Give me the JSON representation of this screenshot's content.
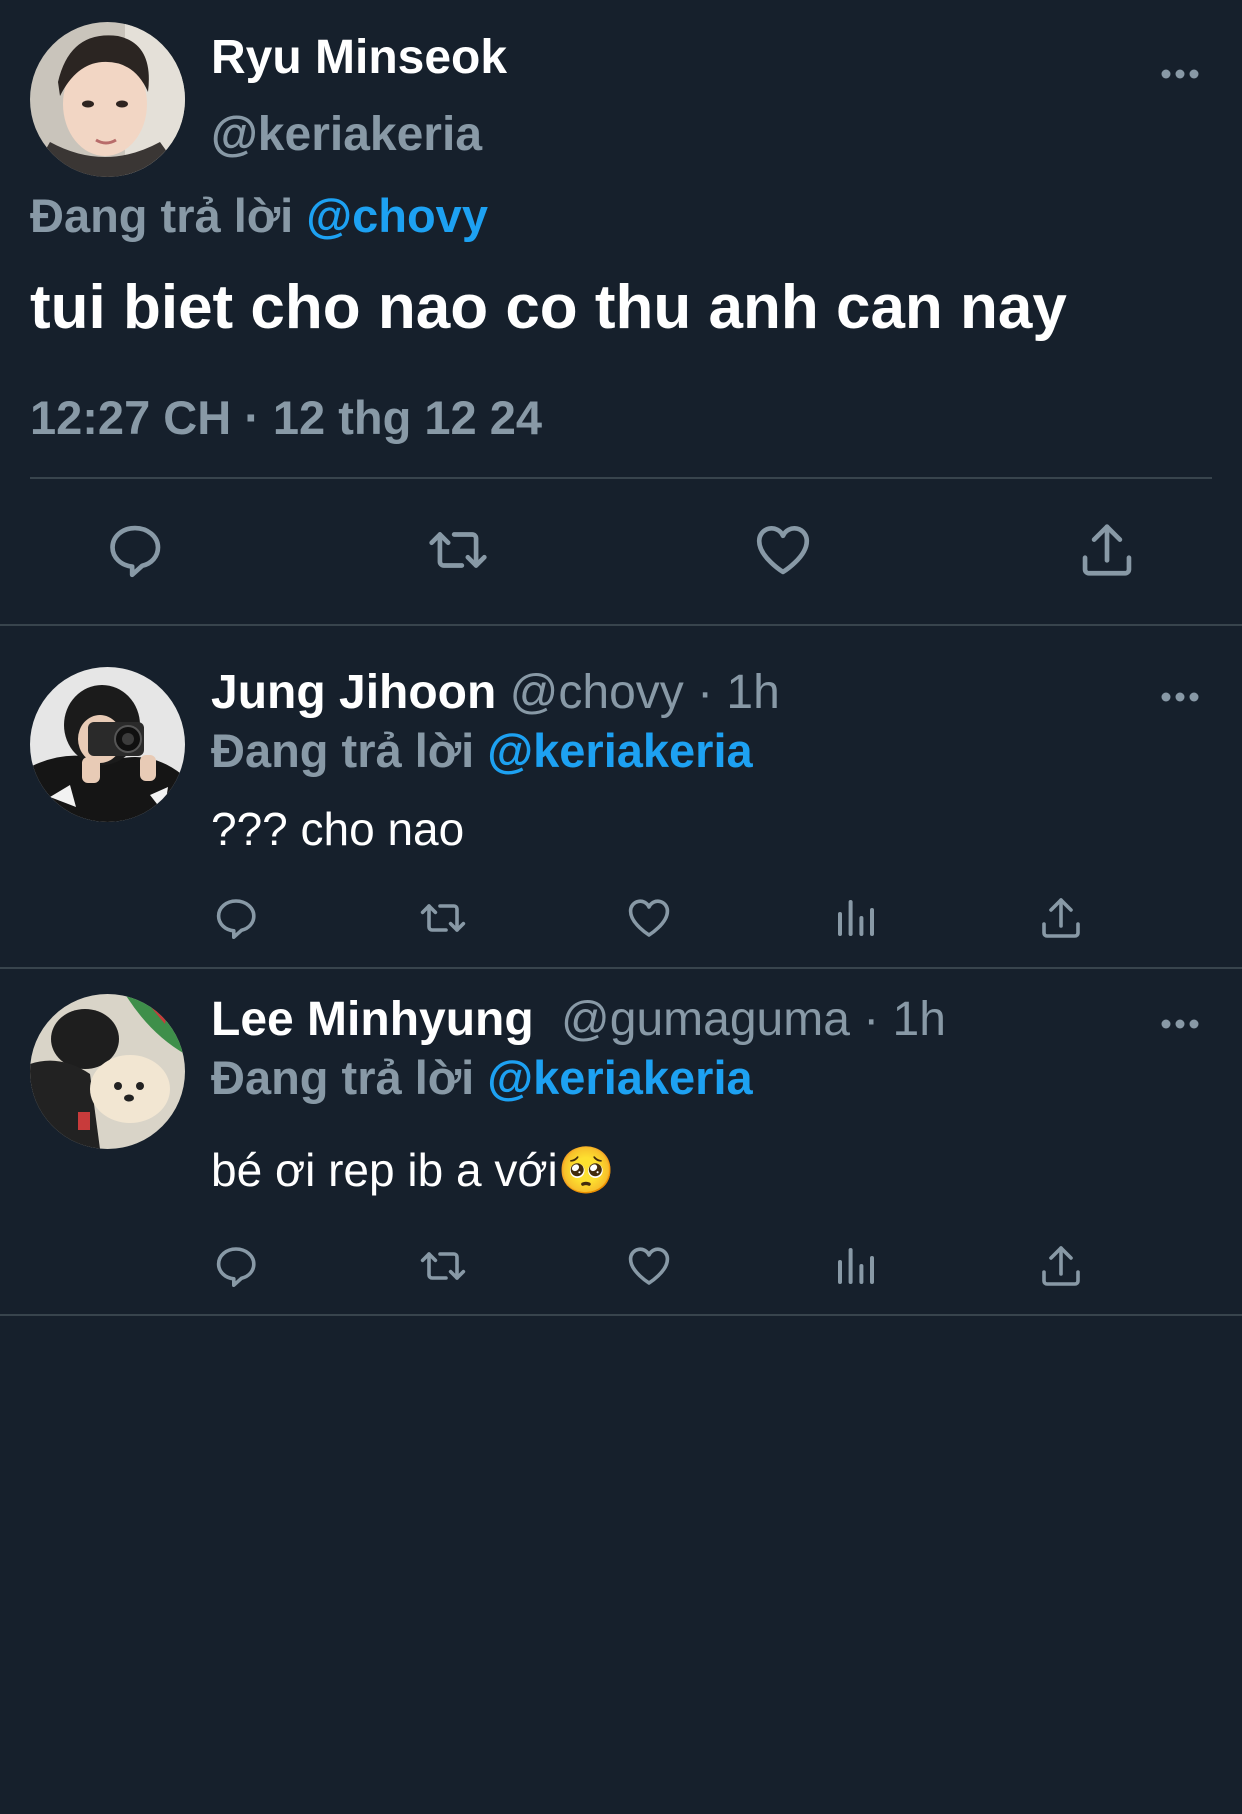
{
  "colors": {
    "background": "#16202c",
    "secondary_text": "#8899a6",
    "accent": "#1da1f2",
    "divider": "#38444d"
  },
  "main_tweet": {
    "author_name": "Ryu Minseok",
    "author_handle": "@keriakeria",
    "reply_prefix": "Đang trả lời",
    "reply_mention": "@chovy",
    "text": "tui biet cho nao co thu anh can nay",
    "meta": "12:27 CH · 12 thg 12 24",
    "more_icon": "more-horizontal-icon",
    "actions": [
      {
        "icon": "reply-icon"
      },
      {
        "icon": "retweet-icon"
      },
      {
        "icon": "like-icon"
      },
      {
        "icon": "share-icon"
      }
    ]
  },
  "replies": [
    {
      "author_name": "Jung Jihoon",
      "author_handle": "@chovy · 1h",
      "reply_prefix": "Đang trả lời",
      "reply_mention": "@keriakeria",
      "text": "??? cho nao",
      "actions": [
        "reply-icon",
        "retweet-icon",
        "like-icon",
        "analytics-icon",
        "share-icon"
      ]
    },
    {
      "author_name": "Lee Minhyung",
      "author_handle": "@gumaguma · 1h",
      "reply_prefix": "Đang trả lời",
      "reply_mention": "@keriakeria",
      "text": "bé ơi rep ib a với🥺",
      "actions": [
        "reply-icon",
        "retweet-icon",
        "like-icon",
        "analytics-icon",
        "share-icon"
      ]
    }
  ]
}
